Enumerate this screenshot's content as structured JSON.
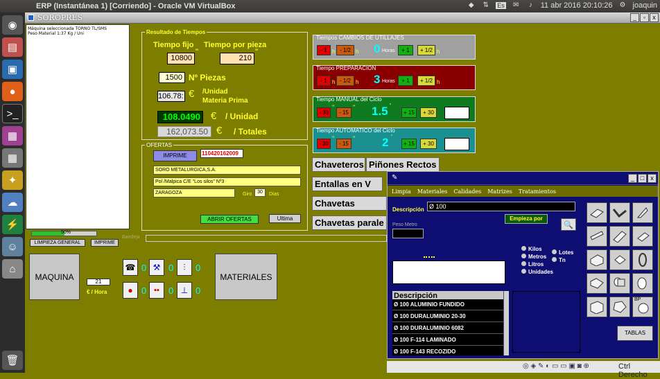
{
  "topbar": {
    "title": "ERP (Instantánea 1) [Corriendo] - Oracle VM VirtualBox",
    "lang": "Es",
    "datetime": "11 abr 2016 20:10:26",
    "user": "joaquin"
  },
  "vm": {
    "title": "SOROPRES"
  },
  "listbox": {
    "lines": [
      "Máquina seleccionada TORNO TL/SMS",
      "Peso Material 1:37 Kg / Uni"
    ]
  },
  "resultado": {
    "header": "Resultado de Tiempos",
    "tiempo_fijo_label": "Tiempo fijo",
    "tiempo_pieza_label": "Tiempo por pieza",
    "tiempo_fijo": "10800",
    "tiempo_pieza": "210",
    "piezas": "1500",
    "piezas_label": "Nº Piezas",
    "unidad_mp": "106.78:",
    "unidad_mp_label": "/Unidad",
    "materia_prima_label": "Materia Prima",
    "precio_unidad": "108.0490",
    "precio_unidad_label": "/ Unidad",
    "totales": "162,073.50",
    "totales_label": "/ Totales"
  },
  "ofertas": {
    "header": "OFERTAS",
    "imprime": "IMPRIME",
    "numero": "110420162009",
    "cliente": "SORO METALURGICA,S.A.",
    "direccion": "Pol /Malpica C/E \"Los silos\" Nº3",
    "ciudad": "ZARAGOZA",
    "giro_label": "Giro",
    "giro": "30",
    "dias_label": "Días",
    "abrir": "ABRIR OFERTAS",
    "ultima": "Ultima"
  },
  "tiempos": {
    "cambios": {
      "header": "Tiempos CAMBIOS DE UTILLAJES",
      "value": "0",
      "unit": "Horas"
    },
    "preparacion": {
      "header": "Tiempo PREPARACION",
      "value": "3",
      "unit": "Horas"
    },
    "manual": {
      "header": "Tiempo MANUAL del Ciclo",
      "value": "1.5"
    },
    "automatico": {
      "header": "Tiempo AUTOMATICO del Ciclo",
      "value": "2"
    },
    "btn_minus1": "- 1",
    "btn_minus_half": "- 1/2",
    "btn_plus1": "+ 1",
    "btn_plus_half": "+ 1/2",
    "btn_minus30": "- 30",
    "btn_minus15": "- 15",
    "btn_plus15": "+ 15",
    "btn_plus30": "+ 30",
    "h": "h"
  },
  "categorias": [
    "Chaveteros",
    "Piñones Rectos",
    "Entallas en V",
    "Chavetas Planas",
    "Chavetas parale"
  ],
  "bottom": {
    "progress_percent": 50,
    "progress_label": "50%",
    "limpieza": "LIMPIEZA GENERAL",
    "imprime": "IMPRIME",
    "bandeja": "Bandeja",
    "maquina": "MAQUINA",
    "materiales": "MATERIALES",
    "euro_hora_value": "21",
    "euro_hora_label": "€ / Hora",
    "counts": [
      "0",
      "0",
      "0",
      "0",
      "0",
      "0"
    ]
  },
  "materiales_win": {
    "menu": [
      "Limpia",
      "Materiales",
      "Calidades",
      "Matrizes",
      "Tratamientos"
    ],
    "descripcion_label": "Descripción",
    "descripcion_value": "Ø 100",
    "empieza": "Empieza por",
    "peso_metro_label": "Peso Metro",
    "units": [
      "Kilos",
      "Metros",
      "Litros",
      "Unidades"
    ],
    "units2": [
      "Lotes",
      "Tn"
    ],
    "list_header": "Descripción",
    "items": [
      "Ø 100 ALUMINIO FUNDIDO",
      "Ø 100 DURALUMINIO 20-30",
      "Ø 100 DURALUMINIO 6082",
      "Ø 100 F-114 LAMINADO",
      "Ø 100 F-143 RECOZIDO"
    ],
    "bp_label": "BP",
    "tablas": "TABLAS"
  },
  "statusbar": {
    "host_key": "Ctrl Derecho"
  },
  "colors": {
    "accent_yellow": "#ffff30",
    "cyan": "#00ffff",
    "vm_bg": "#7d7d00",
    "mat_bg": "#0e0e72"
  }
}
